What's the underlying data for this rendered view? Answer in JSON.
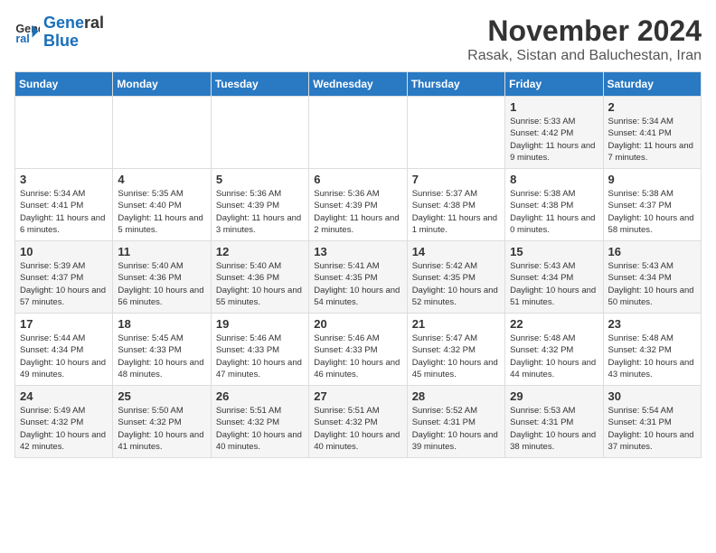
{
  "logo": {
    "line1": "General",
    "line2": "Blue"
  },
  "title": "November 2024",
  "subtitle": "Rasak, Sistan and Baluchestan, Iran",
  "days_of_week": [
    "Sunday",
    "Monday",
    "Tuesday",
    "Wednesday",
    "Thursday",
    "Friday",
    "Saturday"
  ],
  "weeks": [
    [
      {
        "day": "",
        "info": ""
      },
      {
        "day": "",
        "info": ""
      },
      {
        "day": "",
        "info": ""
      },
      {
        "day": "",
        "info": ""
      },
      {
        "day": "",
        "info": ""
      },
      {
        "day": "1",
        "info": "Sunrise: 5:33 AM\nSunset: 4:42 PM\nDaylight: 11 hours and 9 minutes."
      },
      {
        "day": "2",
        "info": "Sunrise: 5:34 AM\nSunset: 4:41 PM\nDaylight: 11 hours and 7 minutes."
      }
    ],
    [
      {
        "day": "3",
        "info": "Sunrise: 5:34 AM\nSunset: 4:41 PM\nDaylight: 11 hours and 6 minutes."
      },
      {
        "day": "4",
        "info": "Sunrise: 5:35 AM\nSunset: 4:40 PM\nDaylight: 11 hours and 5 minutes."
      },
      {
        "day": "5",
        "info": "Sunrise: 5:36 AM\nSunset: 4:39 PM\nDaylight: 11 hours and 3 minutes."
      },
      {
        "day": "6",
        "info": "Sunrise: 5:36 AM\nSunset: 4:39 PM\nDaylight: 11 hours and 2 minutes."
      },
      {
        "day": "7",
        "info": "Sunrise: 5:37 AM\nSunset: 4:38 PM\nDaylight: 11 hours and 1 minute."
      },
      {
        "day": "8",
        "info": "Sunrise: 5:38 AM\nSunset: 4:38 PM\nDaylight: 11 hours and 0 minutes."
      },
      {
        "day": "9",
        "info": "Sunrise: 5:38 AM\nSunset: 4:37 PM\nDaylight: 10 hours and 58 minutes."
      }
    ],
    [
      {
        "day": "10",
        "info": "Sunrise: 5:39 AM\nSunset: 4:37 PM\nDaylight: 10 hours and 57 minutes."
      },
      {
        "day": "11",
        "info": "Sunrise: 5:40 AM\nSunset: 4:36 PM\nDaylight: 10 hours and 56 minutes."
      },
      {
        "day": "12",
        "info": "Sunrise: 5:40 AM\nSunset: 4:36 PM\nDaylight: 10 hours and 55 minutes."
      },
      {
        "day": "13",
        "info": "Sunrise: 5:41 AM\nSunset: 4:35 PM\nDaylight: 10 hours and 54 minutes."
      },
      {
        "day": "14",
        "info": "Sunrise: 5:42 AM\nSunset: 4:35 PM\nDaylight: 10 hours and 52 minutes."
      },
      {
        "day": "15",
        "info": "Sunrise: 5:43 AM\nSunset: 4:34 PM\nDaylight: 10 hours and 51 minutes."
      },
      {
        "day": "16",
        "info": "Sunrise: 5:43 AM\nSunset: 4:34 PM\nDaylight: 10 hours and 50 minutes."
      }
    ],
    [
      {
        "day": "17",
        "info": "Sunrise: 5:44 AM\nSunset: 4:34 PM\nDaylight: 10 hours and 49 minutes."
      },
      {
        "day": "18",
        "info": "Sunrise: 5:45 AM\nSunset: 4:33 PM\nDaylight: 10 hours and 48 minutes."
      },
      {
        "day": "19",
        "info": "Sunrise: 5:46 AM\nSunset: 4:33 PM\nDaylight: 10 hours and 47 minutes."
      },
      {
        "day": "20",
        "info": "Sunrise: 5:46 AM\nSunset: 4:33 PM\nDaylight: 10 hours and 46 minutes."
      },
      {
        "day": "21",
        "info": "Sunrise: 5:47 AM\nSunset: 4:32 PM\nDaylight: 10 hours and 45 minutes."
      },
      {
        "day": "22",
        "info": "Sunrise: 5:48 AM\nSunset: 4:32 PM\nDaylight: 10 hours and 44 minutes."
      },
      {
        "day": "23",
        "info": "Sunrise: 5:48 AM\nSunset: 4:32 PM\nDaylight: 10 hours and 43 minutes."
      }
    ],
    [
      {
        "day": "24",
        "info": "Sunrise: 5:49 AM\nSunset: 4:32 PM\nDaylight: 10 hours and 42 minutes."
      },
      {
        "day": "25",
        "info": "Sunrise: 5:50 AM\nSunset: 4:32 PM\nDaylight: 10 hours and 41 minutes."
      },
      {
        "day": "26",
        "info": "Sunrise: 5:51 AM\nSunset: 4:32 PM\nDaylight: 10 hours and 40 minutes."
      },
      {
        "day": "27",
        "info": "Sunrise: 5:51 AM\nSunset: 4:32 PM\nDaylight: 10 hours and 40 minutes."
      },
      {
        "day": "28",
        "info": "Sunrise: 5:52 AM\nSunset: 4:31 PM\nDaylight: 10 hours and 39 minutes."
      },
      {
        "day": "29",
        "info": "Sunrise: 5:53 AM\nSunset: 4:31 PM\nDaylight: 10 hours and 38 minutes."
      },
      {
        "day": "30",
        "info": "Sunrise: 5:54 AM\nSunset: 4:31 PM\nDaylight: 10 hours and 37 minutes."
      }
    ]
  ]
}
